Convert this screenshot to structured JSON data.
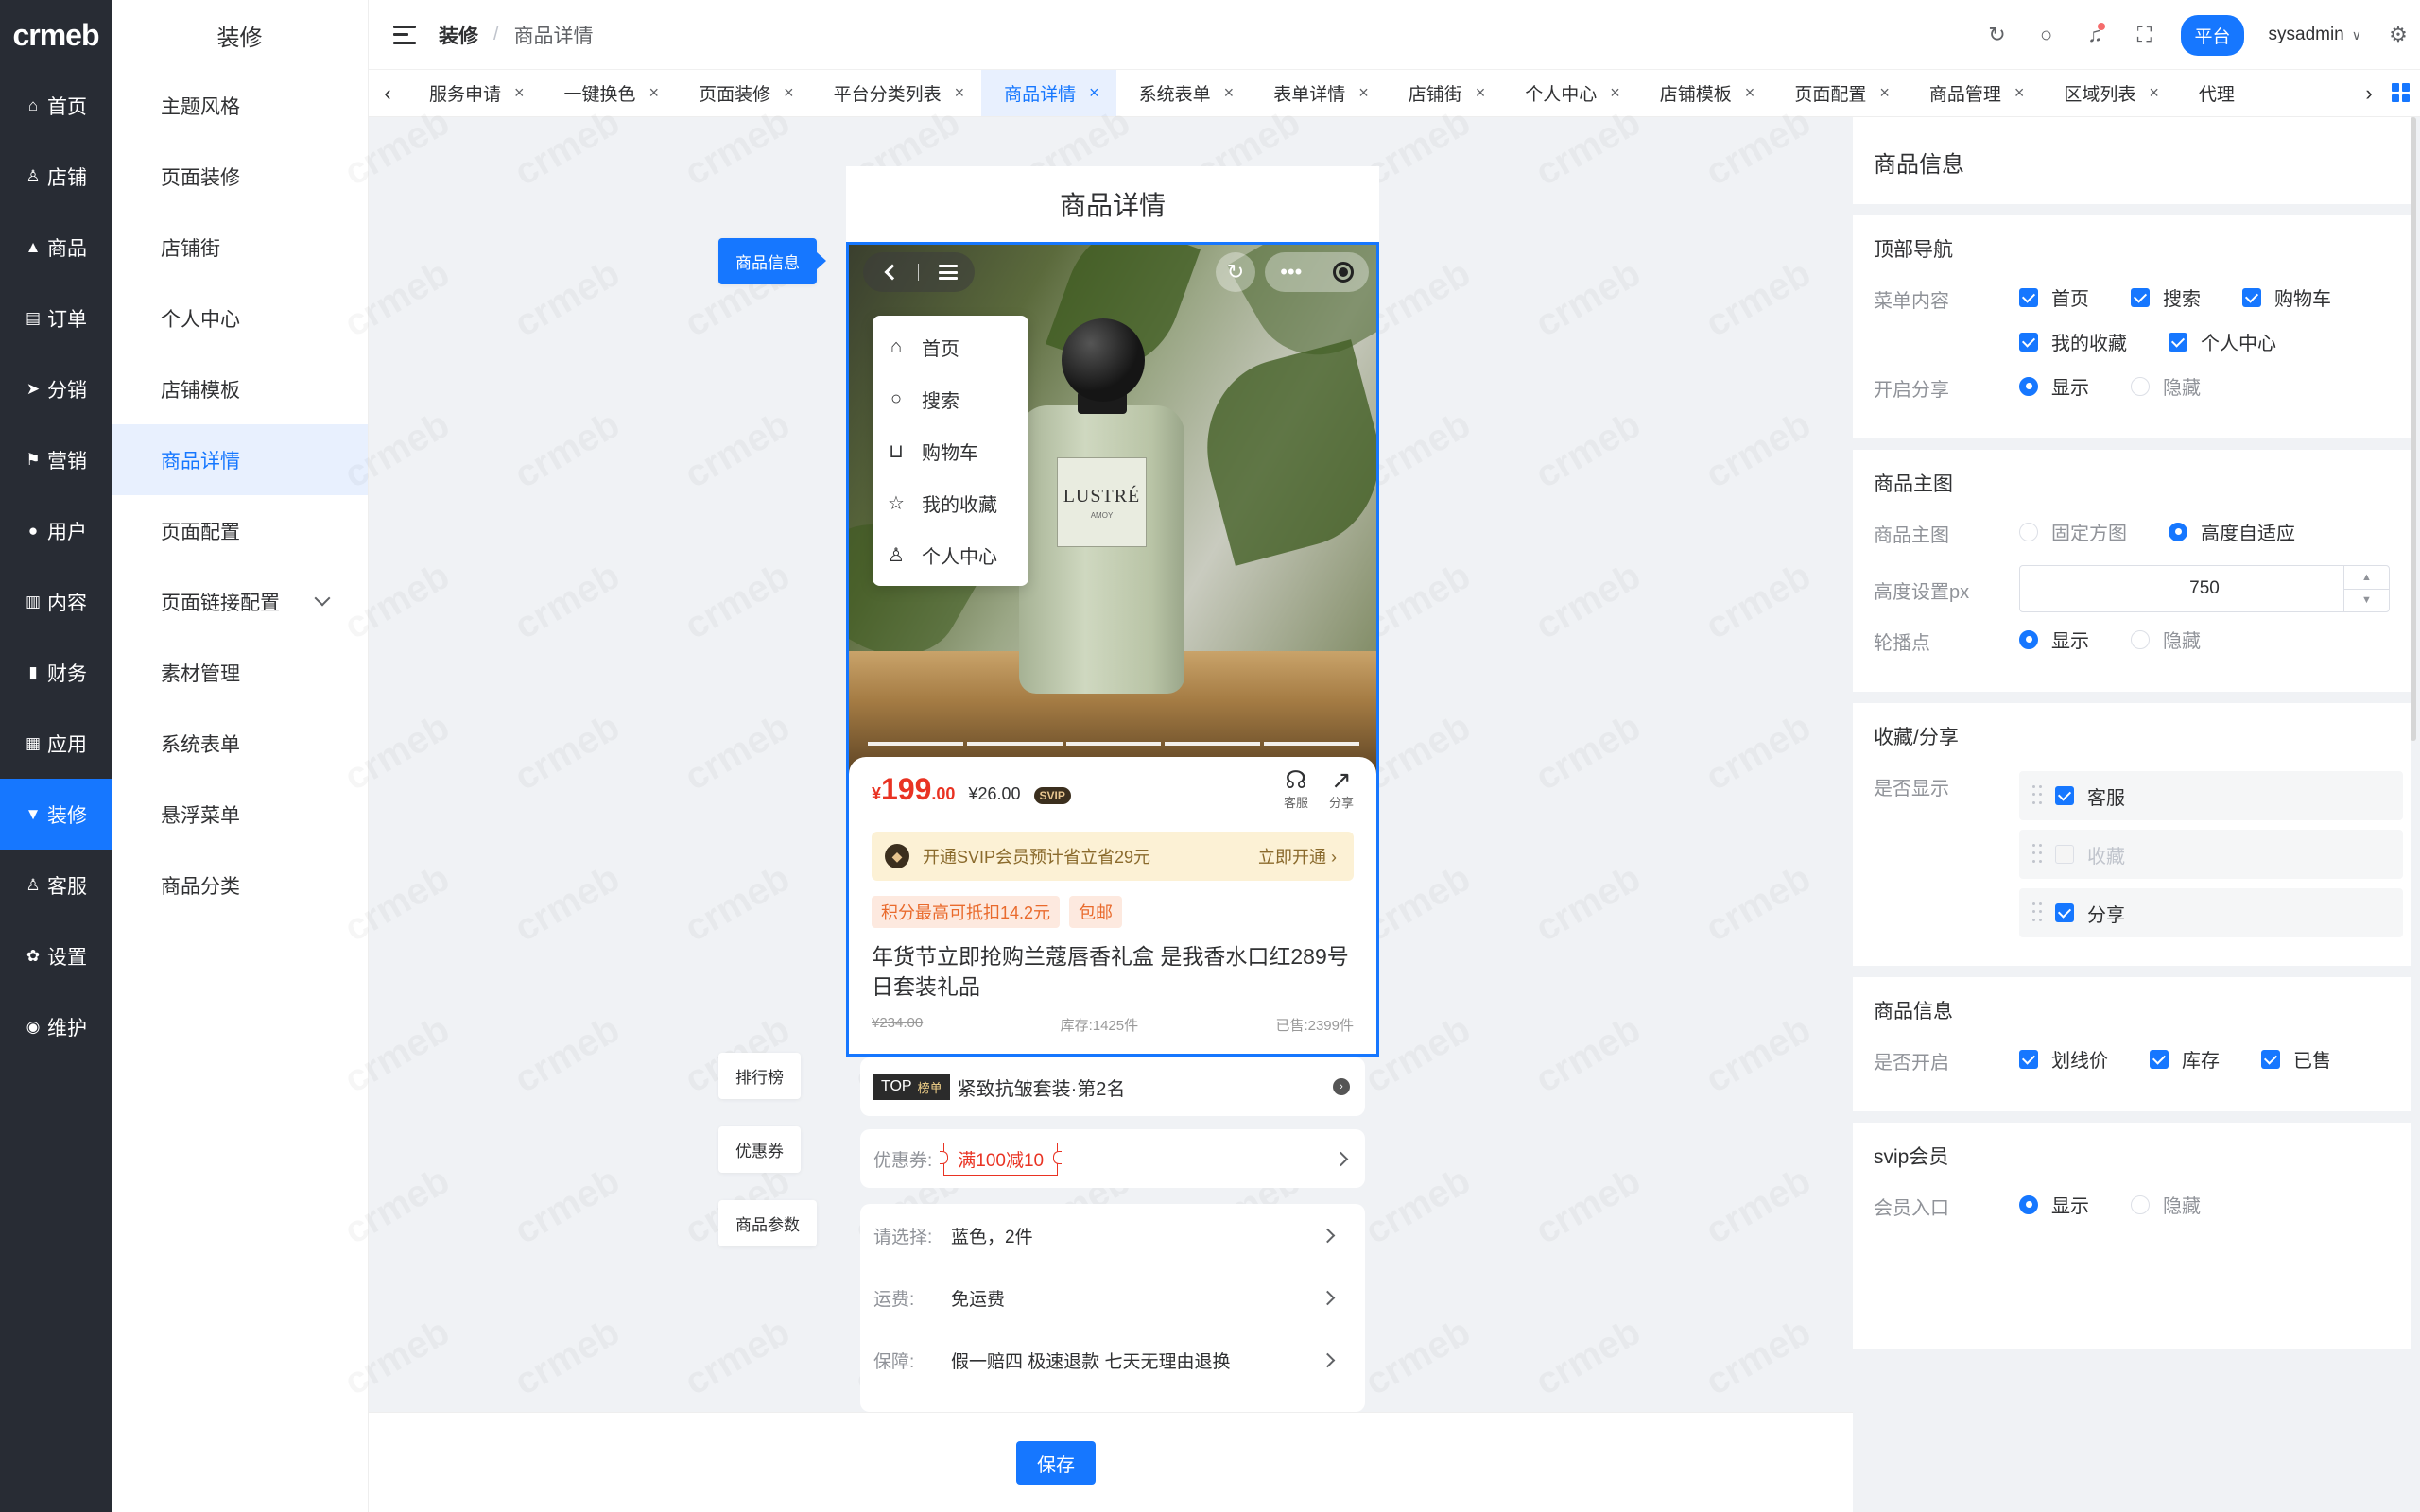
{
  "app": {
    "logo": "crmeb"
  },
  "rail": [
    {
      "label": "首页",
      "icon": "home-icon",
      "glyph": "⌂"
    },
    {
      "label": "店铺",
      "icon": "user-icon",
      "glyph": "♙"
    },
    {
      "label": "商品",
      "icon": "bag-icon",
      "glyph": "▲"
    },
    {
      "label": "订单",
      "icon": "clipboard-icon",
      "glyph": "▤"
    },
    {
      "label": "分销",
      "icon": "send-icon",
      "glyph": "➤"
    },
    {
      "label": "营销",
      "icon": "flag-icon",
      "glyph": "⚑"
    },
    {
      "label": "用户",
      "icon": "person-icon",
      "glyph": "●"
    },
    {
      "label": "内容",
      "icon": "book-icon",
      "glyph": "▥"
    },
    {
      "label": "财务",
      "icon": "bar-chart-icon",
      "glyph": "▮"
    },
    {
      "label": "应用",
      "icon": "grid-icon",
      "glyph": "▦"
    },
    {
      "label": "装修",
      "icon": "brush-icon",
      "glyph": "▼",
      "active": true
    },
    {
      "label": "客服",
      "icon": "headset-icon",
      "glyph": "♙"
    },
    {
      "label": "设置",
      "icon": "gear-icon",
      "glyph": "✿"
    },
    {
      "label": "维护",
      "icon": "wrench-icon",
      "glyph": "◉"
    }
  ],
  "submenu": {
    "title": "装修",
    "items": [
      {
        "label": "主题风格"
      },
      {
        "label": "页面装修"
      },
      {
        "label": "店铺街"
      },
      {
        "label": "个人中心"
      },
      {
        "label": "店铺模板"
      },
      {
        "label": "商品详情",
        "active": true
      },
      {
        "label": "页面配置"
      },
      {
        "label": "页面链接配置",
        "expandable": true
      },
      {
        "label": "素材管理"
      },
      {
        "label": "系统表单"
      },
      {
        "label": "悬浮菜单"
      },
      {
        "label": "商品分类"
      }
    ]
  },
  "header": {
    "breadcrumb": [
      "装修",
      "/",
      "商品详情"
    ],
    "platform": "平台",
    "user": "sysadmin"
  },
  "tabs": [
    {
      "label": "服务申请"
    },
    {
      "label": "一键换色"
    },
    {
      "label": "页面装修"
    },
    {
      "label": "平台分类列表"
    },
    {
      "label": "商品详情",
      "active": true
    },
    {
      "label": "系统表单"
    },
    {
      "label": "表单详情"
    },
    {
      "label": "店铺街"
    },
    {
      "label": "个人中心"
    },
    {
      "label": "店铺模板"
    },
    {
      "label": "页面配置"
    },
    {
      "label": "商品管理"
    },
    {
      "label": "区域列表"
    },
    {
      "label": "代理"
    }
  ],
  "preview": {
    "page_title": "商品详情",
    "pills": {
      "info": "商品信息",
      "rank": "排行榜",
      "coupon": "优惠券",
      "params": "商品参数"
    },
    "dropdown": [
      {
        "label": "首页",
        "icon": "home-icon",
        "glyph": "⌂"
      },
      {
        "label": "搜索",
        "icon": "search-icon",
        "glyph": "○"
      },
      {
        "label": "购物车",
        "icon": "cart-icon",
        "glyph": "⊔"
      },
      {
        "label": "我的收藏",
        "icon": "star-icon",
        "glyph": "☆"
      },
      {
        "label": "个人中心",
        "icon": "person-icon",
        "glyph": "♙"
      }
    ],
    "bottle_brand": "LUSTRÉ",
    "bottle_sub": "AMOY",
    "price": {
      "currency": "¥",
      "main": "199",
      "decimal": ".00",
      "svip": "¥26.00",
      "svip_tag": "SVIP"
    },
    "actions": {
      "service": "客服",
      "share": "分享"
    },
    "svip_banner": {
      "text": "开通SVIP会员预计省立省29元",
      "cta": "立即开通 ›"
    },
    "tags": [
      "积分最高可抵扣14.2元",
      "包邮"
    ],
    "title": "年货节立即抢购兰蔻唇香礼盒 是我香水口红289号日套装礼品",
    "meta": {
      "original": "¥234.00",
      "stock": "库存:1425件",
      "sold": "已售:2399件"
    },
    "rank": {
      "top": "TOP",
      "badge": "榜单",
      "text": "紧致抗皱套装·第2名"
    },
    "coupon": {
      "label": "优惠券:",
      "value": "满100减10"
    },
    "params": [
      {
        "label": "请选择:",
        "value": "蓝色，2件"
      },
      {
        "label": "运费:",
        "value": "免运费"
      },
      {
        "label": "保障:",
        "value": "假一赔四 极速退款 七天无理由退换"
      }
    ]
  },
  "save_label": "保存",
  "panel": {
    "heading": "商品信息",
    "nav": {
      "title": "顶部导航",
      "menu_label": "菜单内容",
      "menu_items": [
        "首页",
        "搜索",
        "购物车",
        "我的收藏",
        "个人中心"
      ],
      "share_label": "开启分享",
      "share_on": "显示",
      "share_off": "隐藏"
    },
    "main_image": {
      "title": "商品主图",
      "mode_label": "商品主图",
      "mode_fixed": "固定方图",
      "mode_auto": "高度自适应",
      "height_label": "高度设置px",
      "height_value": "750",
      "dots_label": "轮播点",
      "dots_on": "显示",
      "dots_off": "隐藏"
    },
    "fav_share": {
      "title": "收藏/分享",
      "show_label": "是否显示",
      "items": [
        {
          "label": "客服",
          "checked": true
        },
        {
          "label": "收藏",
          "checked": false
        },
        {
          "label": "分享",
          "checked": true
        }
      ]
    },
    "product_info": {
      "title": "商品信息",
      "enable_label": "是否开启",
      "items": [
        "划线价",
        "库存",
        "已售"
      ]
    },
    "svip": {
      "title": "svip会员",
      "entry_label": "会员入口",
      "on": "显示",
      "off": "隐藏"
    }
  }
}
